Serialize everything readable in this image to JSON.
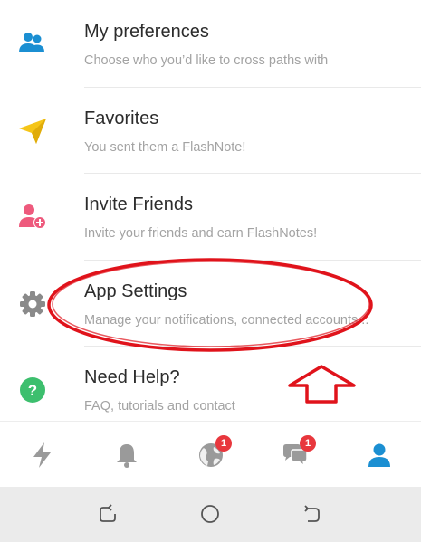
{
  "menu": {
    "items": [
      {
        "title": "My preferences",
        "subtitle": "Choose who you’d like to cross paths with",
        "icon": "users-icon"
      },
      {
        "title": "Favorites",
        "subtitle": "You sent them a FlashNote!",
        "icon": "paper-plane-icon"
      },
      {
        "title": "Invite Friends",
        "subtitle": "Invite your friends and earn FlashNotes!",
        "icon": "add-user-icon"
      },
      {
        "title": "App Settings",
        "subtitle": "Manage your notifications, connected accounts...",
        "icon": "gear-icon"
      },
      {
        "title": "Need Help?",
        "subtitle": "FAQ, tutorials and contact",
        "icon": "help-icon"
      }
    ]
  },
  "bottom_nav": {
    "explore_badge": "1",
    "messages_badge": "1",
    "active_tab": "profile"
  },
  "colors": {
    "accent_blue": "#1b8fd2",
    "favorites_yellow": "#f5c518",
    "invite_pink": "#ee5a7d",
    "help_green": "#3dbf6e",
    "badge_red": "#e8373d",
    "annotation_red": "#e0131b"
  }
}
